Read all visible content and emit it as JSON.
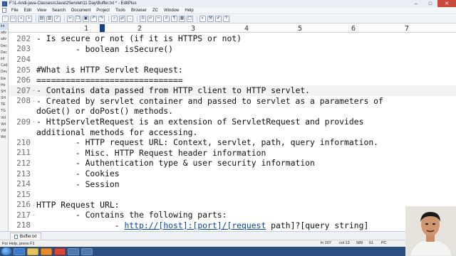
{
  "window": {
    "title": "F:\\1-Andi-java-Classess\\Java\\2Servlet\\11 Day\\Buffer.txt * - EditPlus",
    "buttons": [
      "–",
      "□",
      "✕"
    ]
  },
  "menu": [
    "File",
    "Edit",
    "View",
    "Search",
    "Document",
    "Project",
    "Tools",
    "Browser",
    "ZC",
    "Window",
    "Help"
  ],
  "ruler": {
    "marks": [
      "1",
      "2",
      "3",
      "4",
      "5",
      "6",
      "7"
    ]
  },
  "sidebar": {
    "items": [
      "int",
      "adv",
      "adv",
      "Dec",
      "Dec",
      "inf",
      "Cod",
      "Dev",
      "Ele",
      "Ho",
      "SH",
      "SH",
      "TE",
      "TG",
      "Virt",
      "Virt",
      "VM",
      "Wo"
    ]
  },
  "editor": {
    "lines": [
      {
        "num": "202",
        "fold": "",
        "text": "- Is secure or not (if it is HTTPS or not)"
      },
      {
        "num": "203",
        "fold": "",
        "text": "        - boolean isSecure()"
      },
      {
        "num": "204",
        "fold": "",
        "text": ""
      },
      {
        "num": "205",
        "fold": "",
        "text": "#What is HTTP Servlet Request:"
      },
      {
        "num": "206",
        "fold": "",
        "text": "=============================="
      },
      {
        "num": "207",
        "fold": "-",
        "text": "- Contains data passed from HTTP client to HTTP servlet."
      },
      {
        "num": "208",
        "fold": "-",
        "text": "- Created by servlet container and passed to servlet as a parameters of"
      },
      {
        "num": "",
        "fold": "",
        "text": "doGet() or doPost() methods."
      },
      {
        "num": "209",
        "fold": "-",
        "text": "- HttpServletRequest is an extension of ServletRequest and provides"
      },
      {
        "num": "",
        "fold": "",
        "text": "additional methods for accessing."
      },
      {
        "num": "210",
        "fold": "",
        "text": "        - HTTP request URL: Context, servlet, path, query information."
      },
      {
        "num": "211",
        "fold": "",
        "text": "        - Misc. HTTP Request header information"
      },
      {
        "num": "212",
        "fold": "",
        "text": "        - Authentication type & user security information"
      },
      {
        "num": "213",
        "fold": "",
        "text": "        - Cookies"
      },
      {
        "num": "214",
        "fold": "",
        "text": "        - Session"
      },
      {
        "num": "215",
        "fold": "",
        "text": ""
      },
      {
        "num": "216",
        "fold": "-",
        "text": "HTTP Request URL:"
      },
      {
        "num": "217",
        "fold": "-",
        "text": "        - Contains the following parts:"
      },
      {
        "num": "218",
        "fold": "",
        "text": "                - ",
        "link": "http://[host]:[port]/[request",
        "tail": " path]?[query string]"
      }
    ]
  },
  "tab": {
    "label": "Buffer.txt"
  },
  "status": {
    "help": "For Help, press F1",
    "ln": "ln 207",
    "col": "col 13",
    "chars": "589",
    "lines": "61",
    "mode": "PC"
  }
}
